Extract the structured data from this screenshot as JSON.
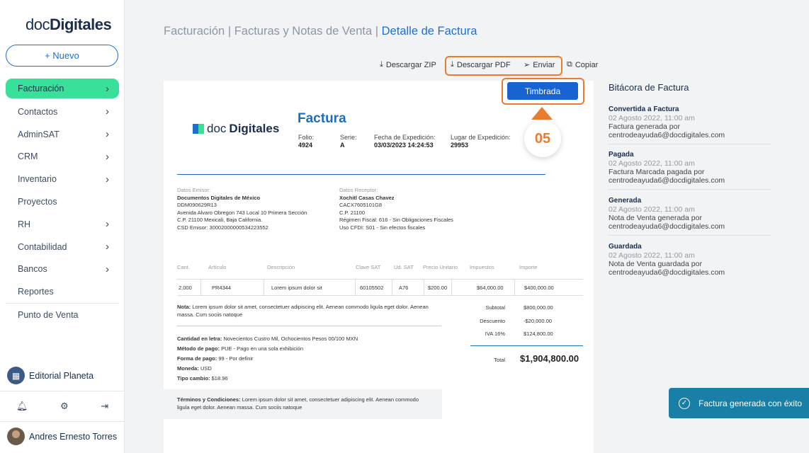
{
  "sidebar": {
    "logo_doc": "doc",
    "logo_dig": "Digitales",
    "new_button": "+ Nuevo",
    "items": [
      {
        "label": "Facturación",
        "chevron": true
      },
      {
        "label": "Contactos",
        "chevron": true
      },
      {
        "label": "AdminSAT",
        "chevron": true
      },
      {
        "label": "CRM",
        "chevron": true
      },
      {
        "label": "Inventario",
        "chevron": true
      },
      {
        "label": "Proyectos",
        "chevron": false
      },
      {
        "label": "RH",
        "chevron": true
      },
      {
        "label": "Contabilidad",
        "chevron": true
      },
      {
        "label": "Bancos",
        "chevron": true
      },
      {
        "label": "Reportes",
        "chevron": false
      },
      {
        "label": "Punto de Venta",
        "chevron": false
      }
    ],
    "company": "Editorial Planeta",
    "user": "Andres Ernesto Torres"
  },
  "header": {
    "crumb1": "Facturación",
    "sep": "|",
    "crumb2": "Facturas y Notas de Venta",
    "crumb3": "Detalle de Factura"
  },
  "actions": {
    "zip": "Descargar ZIP",
    "pdf": "Descargar PDF",
    "send": "Enviar",
    "copy": "Copiar"
  },
  "invoice": {
    "status": "Timbrada",
    "logo_doc": "doc",
    "logo_dig": "Digitales",
    "title": "Factura",
    "folio_label": "Folio:",
    "folio": "4924",
    "serie_label": "Serie:",
    "serie": "A",
    "fecha_label": "Fecha de Expedición:",
    "fecha": "03/03/2023 14:24:53",
    "lugar_label": "Lugar de Expedición:",
    "lugar": "29953",
    "emisor": {
      "label": "Datos Emisor:",
      "lines": [
        "Documentos Digitales de México",
        "DDM090629R13",
        "Avenida Alvaro Obregon 743 Local 10 Primera Sección",
        "C.P. 21100 Mexicali, Baja California.",
        "CSD Emisor: 30002000000534223552"
      ]
    },
    "receptor": {
      "label": "Datos Receptor:",
      "lines": [
        "Xochitl Casas Chavez",
        "CACX7605101G8",
        "C.P. 21100",
        "Régimen Fiscal: 616 - Sin Obligaciones Fiscales",
        "Uso CFDI: S01 - Sin efectos fiscales"
      ]
    },
    "columns": [
      "Cant.",
      "Artículo",
      "Descripción",
      "Clave SAT",
      "Ud. SAT",
      "Precio Unitario",
      "Impuestos",
      "Importe"
    ],
    "row": [
      "2,000",
      "PR4344",
      "Lorem ipsum dolor sit",
      "60105502",
      "A76",
      "$200.00",
      "$64,000.00",
      "$400,000.00"
    ],
    "note_label": "Nota:",
    "note": "Lorem ipsum dolor sit amet, consectetuer adipiscing elit. Aenean commodo ligula eget dolor. Aenean massa. Cum sociis natoque",
    "pay": [
      {
        "k": "Cantidad en letra:",
        "v": "Novecientos Custro Mil, Ochocientos Pesos 00/100 MXN"
      },
      {
        "k": "Método de pago:",
        "v": "PUE - Pago en una sola exhibición"
      },
      {
        "k": "Forma de pago:",
        "v": "99 - Por definir"
      },
      {
        "k": "Moneda:",
        "v": "USD"
      },
      {
        "k": "Tipo cambio:",
        "v": "$18.96"
      }
    ],
    "totals": [
      {
        "k": "Subtotal",
        "v": "$800,000.00"
      },
      {
        "k": "Descuento",
        "v": "-$20,000.00"
      },
      {
        "k": "IVA 16%",
        "v": "$124,800.00"
      }
    ],
    "total_label": "Total",
    "total": "$1,904,800.00",
    "terms_label": "Términos y Condiciones:",
    "terms": "Lorem ipsum dolor sit amet, consectetuer adipiscing elit. Aenean commodo ligula eget dolor. Aenean massa. Cum sociis natoque"
  },
  "step": "05",
  "log": {
    "title": "Bitácora de Factura",
    "entries": [
      {
        "title": "Convertida a Factura",
        "date": "02 Agosto 2022, 11:00 am",
        "text1": "Factura generada por",
        "text2": "centrodeayuda6@docdigitales.com"
      },
      {
        "title": "Pagada",
        "date": "02 Agosto 2022, 11:00 am",
        "text1": "Factura Marcada pagada por",
        "text2": "centrodeayuda6@docdigitales.com"
      },
      {
        "title": "Generada",
        "date": "02 Agosto 2022, 11:00 am",
        "text1": "Nota de Venta generada por",
        "text2": "centrodeayuda6@docdigitales.com"
      },
      {
        "title": "Guardada",
        "date": "02 Agosto 2022, 11:00 am",
        "text1": "Nota de Venta guardada por",
        "text2": "centrodeayuda6@docdigitales.com"
      }
    ]
  },
  "toast": "Factura generada con éxito",
  "colors": {
    "accent": "#38e09a",
    "brand": "#1f6fd1",
    "highlight": "#ea7c2f",
    "toast": "#1a7fa6"
  }
}
